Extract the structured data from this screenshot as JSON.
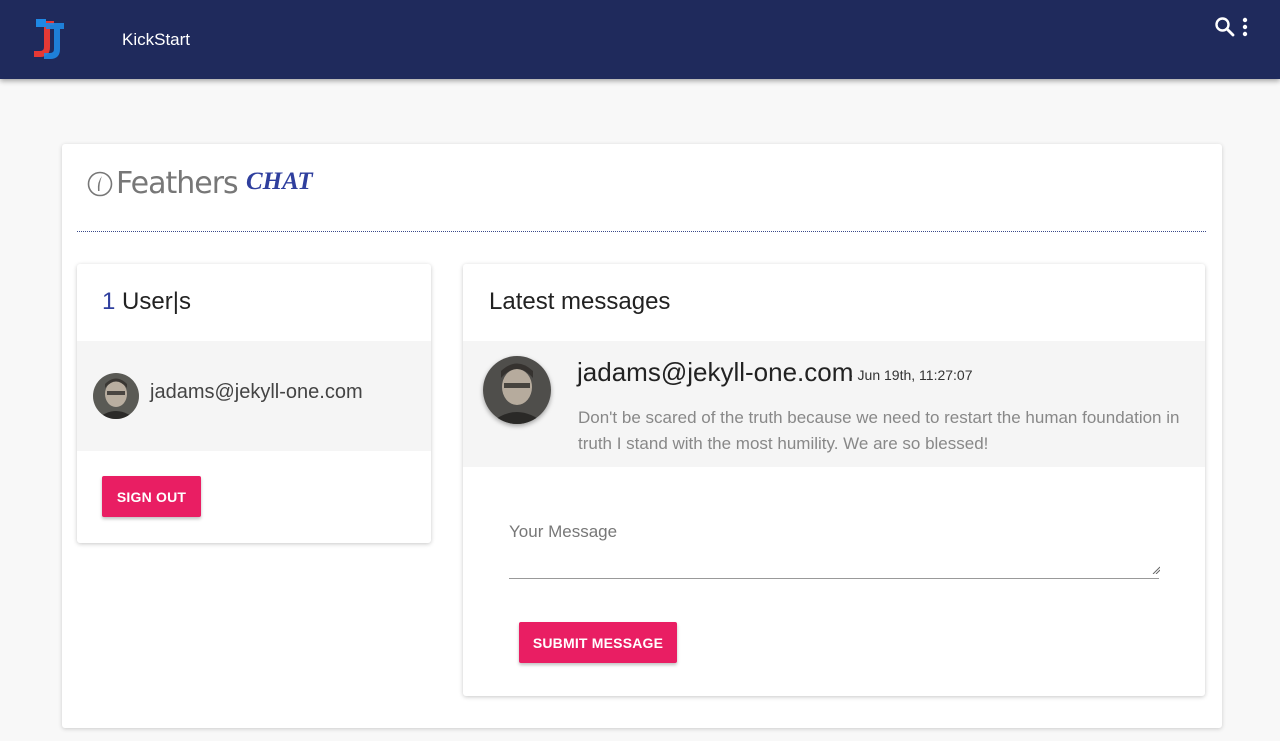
{
  "header": {
    "app_title": "KickStart",
    "background_color": "#1f2a5c",
    "logo_icon": "j1-logo-icon",
    "search_icon": "search-icon",
    "menu_icon": "more-vert-icon"
  },
  "brand": {
    "name": "Feathers",
    "suffix": "CHAT",
    "suffix_color": "#2f3f9e"
  },
  "users_panel": {
    "count": "1",
    "label": "User|s",
    "users": [
      {
        "email": "jadams@jekyll-one.com",
        "avatar": "user-avatar"
      }
    ],
    "sign_out_label": "SIGN OUT"
  },
  "messages_panel": {
    "title": "Latest messages",
    "messages": [
      {
        "author": "jadams@jekyll-one.com",
        "time": "· Jun 19th, 11:27:07",
        "text": "Don't be scared of the truth because we need to restart the human foundation in truth I stand with the most humility. We are so blessed!"
      }
    ],
    "input_placeholder": "Your Message",
    "submit_label": "SUBMIT MESSAGE"
  },
  "accent_color": "#e91e63"
}
